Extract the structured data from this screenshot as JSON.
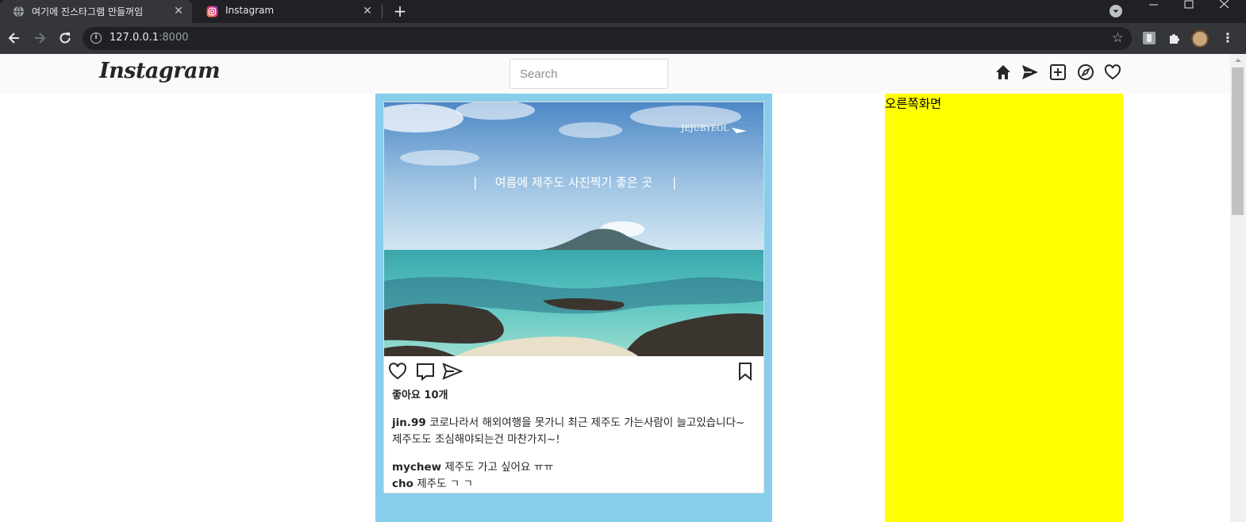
{
  "browser": {
    "tabs": [
      {
        "title": "여기에 진스타그램 만들꺼임",
        "active": true
      },
      {
        "title": "Instagram",
        "active": false
      }
    ],
    "url_host": "127.0.0.1",
    "url_port": ":8000"
  },
  "nav": {
    "logo": "Instagram",
    "search_placeholder": "Search",
    "icons": [
      "home-icon",
      "direct-icon",
      "new-post-icon",
      "explore-icon",
      "activity-icon"
    ]
  },
  "post": {
    "photo_watermark": "JEJUBYEOL",
    "photo_overlay": "여름에 제주도 사진찍기 좋은 곳",
    "likes": "좋아요 10개",
    "author": "jin.99",
    "caption": "코로나라서 해외여행을 못가니 최근 제주도 가는사람이 늘고있습니다~ 제주도도 조심해야되는건 마찬가지~!",
    "comments": [
      {
        "user": "mychew",
        "text": "제주도 가고 싶어요 ㅠㅠ"
      },
      {
        "user": "cho",
        "text": "제주도 ㄱ ㄱ"
      }
    ]
  },
  "right_panel": {
    "text": "오른쪽화면"
  },
  "colors": {
    "feed_bg": "#87ceeb",
    "right_panel_bg": "#ffff00",
    "nav_bg": "#fafafa"
  }
}
